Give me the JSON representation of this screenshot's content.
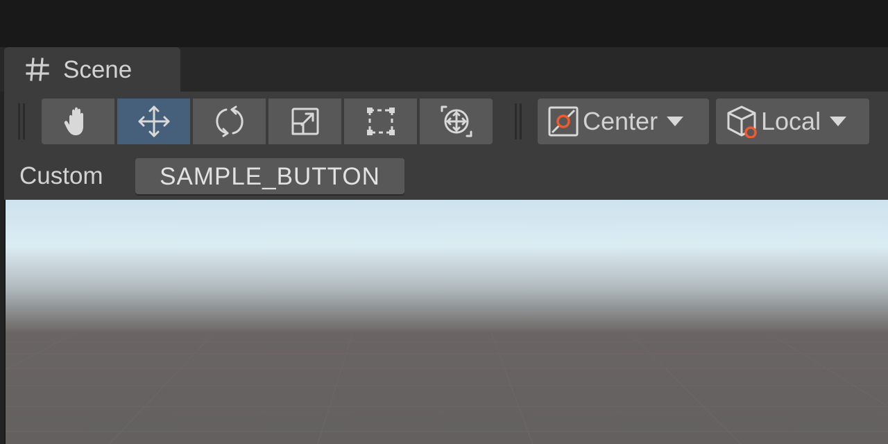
{
  "tab": {
    "label": "Scene",
    "icon": "hash-grid-icon"
  },
  "toolbar": {
    "tools": [
      {
        "name": "hand-tool",
        "icon": "hand-icon",
        "active": false
      },
      {
        "name": "move-tool",
        "icon": "move-arrows-icon",
        "active": true
      },
      {
        "name": "rotate-tool",
        "icon": "rotate-icon",
        "active": false
      },
      {
        "name": "scale-tool",
        "icon": "scale-icon",
        "active": false
      },
      {
        "name": "rect-tool",
        "icon": "rect-transform-icon",
        "active": false
      },
      {
        "name": "transform-tool",
        "icon": "transform-icon",
        "active": false
      }
    ],
    "pivot_position": {
      "label": "Center",
      "icon": "pivot-center-icon"
    },
    "pivot_rotation": {
      "label": "Local",
      "icon": "pivot-local-icon"
    }
  },
  "custom_row": {
    "label": "Custom",
    "button_label": "SAMPLE_BUTTON"
  },
  "colors": {
    "accent_active": "#46607c",
    "pivot_accent": "#f05a30",
    "text": "#d2d2d2",
    "panel": "#3c3c3c",
    "button": "#585858"
  }
}
